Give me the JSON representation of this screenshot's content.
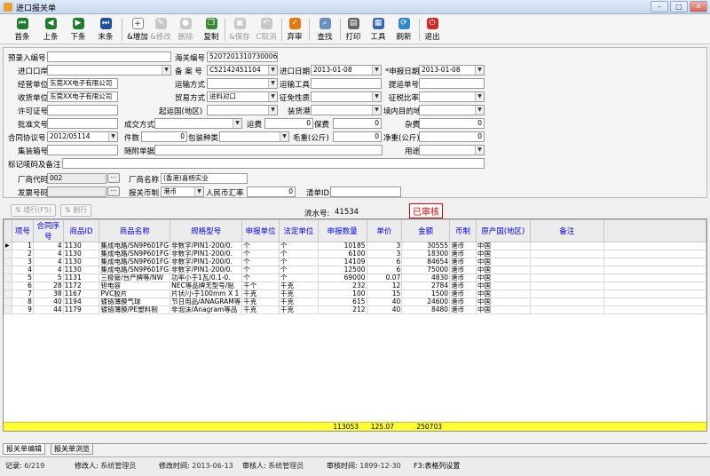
{
  "window": {
    "title": "进口报关单"
  },
  "toolbar": {
    "first": "首条",
    "prev": "上条",
    "next": "下条",
    "last": "末条",
    "add": "&增加",
    "edit": "&修改",
    "delete": "删除",
    "copy": "复制",
    "save": "&保存",
    "cancel": "C取消",
    "abandon": "弃审",
    "find": "查找",
    "print": "打印",
    "tools": "工具",
    "refresh": "刷新",
    "exit": "退出"
  },
  "form": {
    "prerecord_label": "预录入编号",
    "prerecord_value": "",
    "customs_no_label": "海关编号",
    "customs_no_value": "520720131073000671",
    "import_port_label": "进口口岸",
    "import_port_value": "",
    "record_no_label": "备 案 号",
    "record_no_value": "C52142451104",
    "import_date_label": "进口日期",
    "import_date_value": "2013-01-08",
    "declare_date_label": "*申报日期",
    "declare_date_value": "2013-01-08",
    "operator_label": "经营单位",
    "operator_value": "东莞XX电子有限公司",
    "transport_mode_label": "运输方式",
    "transport_mode_value": "",
    "transport_tool_label": "运输工具",
    "transport_tool_value": "",
    "bill_no_label": "提运单号",
    "bill_no_value": "",
    "consignee_label": "收货单位",
    "consignee_value": "东莞XX电子有限公司",
    "trade_mode_label": "贸易方式",
    "trade_mode_value": "进料对口",
    "exemption_label": "征免性质",
    "exemption_value": "",
    "tax_rate_label": "征税比率",
    "tax_rate_value": "",
    "license_label": "许可证号",
    "license_value": "",
    "origin_country_label": "起运国(地区)",
    "origin_country_value": "",
    "loading_port_label": "装货港",
    "loading_port_value": "",
    "destination_label": "境内目的地",
    "destination_value": "",
    "approval_label": "批准文号",
    "approval_value": "",
    "deal_mode_label": "成交方式",
    "deal_mode_value": "",
    "freight_label": "运费",
    "freight_value": "0",
    "insurance_label": "保费",
    "insurance_value": "0",
    "misc_label": "杂费",
    "misc_value": "0",
    "contract_label": "合同协议号",
    "contract_value": "2012/05114",
    "pieces_label": "件数",
    "pieces_value": "0",
    "package_label": "包装种类",
    "package_value": "",
    "gross_label": "毛重(公斤)",
    "gross_value": "0",
    "net_label": "净重(公斤)",
    "net_value": "0",
    "container_label": "集装箱号",
    "container_value": "",
    "docs_label": "随附单据",
    "docs_value": "",
    "usage_label": "用途",
    "usage_value": "",
    "marks_label": "标记唛码及备注",
    "marks_value": "",
    "vendor_code_label": "厂商代码",
    "vendor_code_value": "002",
    "vendor_name_label": "厂商名称",
    "vendor_name_value": "(香港)喜杨实业",
    "invoice_label": "发票号码",
    "invoice_value": "",
    "currency_label": "报关币制",
    "currency_value": "港币",
    "rmb_rate_label": "人民币汇率",
    "rmb_rate_value": "0",
    "clearance_label": "清单ID",
    "clearance_value": ""
  },
  "actions": {
    "add_row": "增行(F5)",
    "del_row": "删行"
  },
  "serial": {
    "label": "流水号:",
    "value": "41534"
  },
  "approved_stamp": "已审核",
  "columns": [
    "项号",
    "合同序号",
    "商品ID",
    "商品名称",
    "规格型号",
    "申报单位",
    "法定单位",
    "申报数量",
    "单价",
    "金额",
    "币制",
    "原产国(地区)",
    "备注"
  ],
  "rows": [
    [
      "1",
      "4",
      "1130",
      "集成电路/SN9P601FG",
      "非数字/PIN1-200/0.",
      "个",
      "个",
      "10185",
      "3",
      "30555",
      "港币",
      "中国",
      ""
    ],
    [
      "2",
      "4",
      "1130",
      "集成电路/SN9P601FG",
      "非数字/PIN1-200/0.",
      "个",
      "个",
      "6100",
      "3",
      "18300",
      "港币",
      "中国",
      ""
    ],
    [
      "3",
      "4",
      "1130",
      "集成电路/SN9P601FG",
      "非数字/PIN1-200/0.",
      "个",
      "个",
      "14109",
      "6",
      "84654",
      "港币",
      "中国",
      ""
    ],
    [
      "4",
      "4",
      "1130",
      "集成电路/SN9P601FG",
      "非数字/PIN1-200/0.",
      "个",
      "个",
      "12500",
      "6",
      "75000",
      "港币",
      "中国",
      ""
    ],
    [
      "5",
      "5",
      "1131",
      "三极管/台产牌等/NW",
      "功率小于1瓦/0.1-0.",
      "个",
      "个",
      "69000",
      "0.07",
      "4830",
      "港币",
      "中国",
      ""
    ],
    [
      "6",
      "28",
      "1172",
      "钽电容",
      "NEC等品牌无型号/贴",
      "千个",
      "千克",
      "232",
      "12",
      "2784",
      "港币",
      "中国",
      ""
    ],
    [
      "7",
      "38",
      "1167",
      "PVC胶片",
      "片状/小于100mm X 1",
      "千克",
      "千克",
      "100",
      "15",
      "1500",
      "港币",
      "中国",
      ""
    ],
    [
      "8",
      "40",
      "1194",
      "镀铬薄膜气球",
      "节日用品/ANAGRAM等",
      "千克",
      "千克",
      "615",
      "40",
      "24600",
      "港币",
      "中国",
      ""
    ],
    [
      "9",
      "44",
      "1179",
      "镀铬薄膜/PE塑料制",
      "非泡沫/Anagram等品",
      "千克",
      "千克",
      "212",
      "40",
      "8480",
      "港币",
      "中国",
      ""
    ]
  ],
  "totals": {
    "qty": "113053",
    "price": "125.07",
    "amount": "250703"
  },
  "tabs": [
    "报关单编辑",
    "报关单浏览"
  ],
  "status": {
    "record_label": "记录:",
    "record_value": "6/219",
    "modifier_label": "修改人:",
    "modifier_value": "系统管理员",
    "modtime_label": "修改时间:",
    "modtime_value": "2013-06-13",
    "auditor_label": "审核人:",
    "auditor_value": "系统管理员",
    "audittime_label": "审核时间:",
    "audittime_value": "1899-12-30",
    "hint": "F3:表格列设置"
  }
}
